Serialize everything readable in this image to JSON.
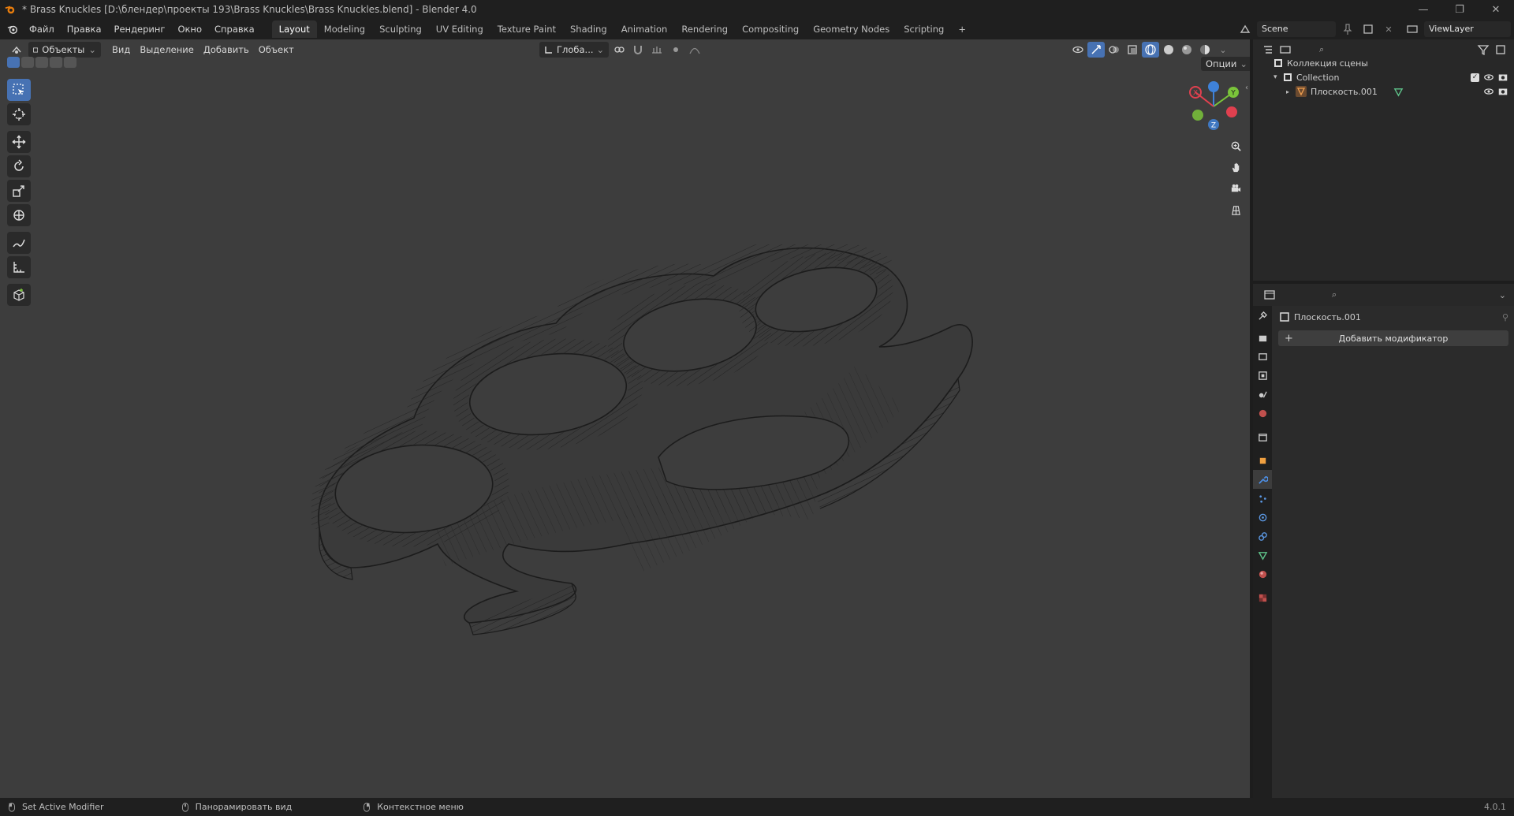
{
  "window": {
    "title": "* Brass Knuckles [D:\\блендер\\проекты 193\\Brass Knuckles\\Brass Knuckles.blend] - Blender 4.0"
  },
  "menu": [
    "Файл",
    "Правка",
    "Рендеринг",
    "Окно",
    "Справка"
  ],
  "workspaces": [
    "Layout",
    "Modeling",
    "Sculpting",
    "UV Editing",
    "Texture Paint",
    "Shading",
    "Animation",
    "Rendering",
    "Compositing",
    "Geometry Nodes",
    "Scripting"
  ],
  "active_workspace": "Layout",
  "scene": {
    "name": "Scene",
    "view_layer": "ViewLayer"
  },
  "viewport_header": {
    "mode": "Объекты",
    "menus": [
      "Вид",
      "Выделение",
      "Добавить",
      "Объект"
    ],
    "orientation": "Глоба...",
    "options_label": "Опции"
  },
  "outliner": {
    "root": "Коллекция сцены",
    "collection": "Collection",
    "object": "Плоскость.001"
  },
  "properties": {
    "object_name": "Плоскость.001",
    "add_modifier": "Добавить модификатор"
  },
  "gizmo_axes": [
    "X",
    "Y",
    "Z"
  ],
  "statusbar": {
    "left": "Set Active Modifier",
    "middle": "Панорамировать вид",
    "right": "Контекстное меню",
    "version": "4.0.1"
  },
  "colors": {
    "accent": "#4772b3",
    "axis_x": "#e0404f",
    "axis_y": "#7ac43a",
    "axis_z": "#3f82d9"
  }
}
